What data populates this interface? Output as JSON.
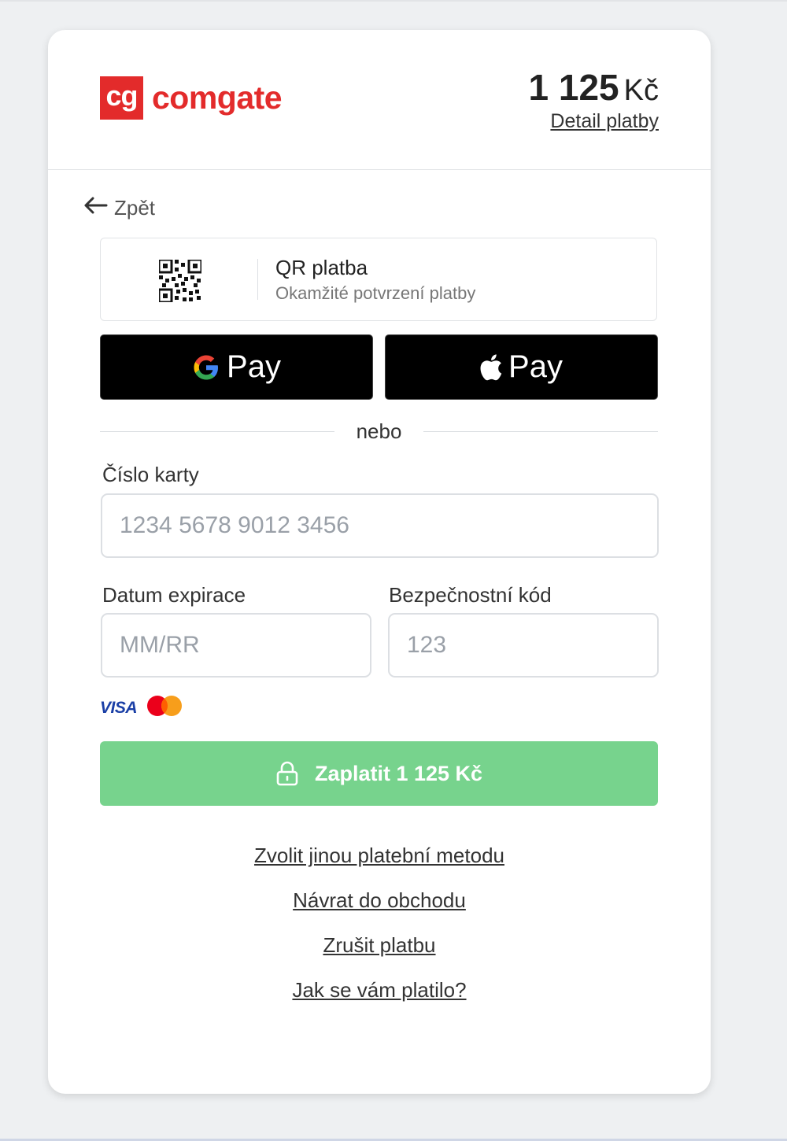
{
  "brand": {
    "logo_mark": "cg",
    "name": "comgate",
    "color": "#e32b2b"
  },
  "payment": {
    "amount": "1 125",
    "currency": "Kč",
    "detail_link": "Detail platby"
  },
  "nav": {
    "back_label": "Zpět"
  },
  "qr_option": {
    "title": "QR platba",
    "subtitle": "Okamžité potvrzení platby"
  },
  "wallets": {
    "google_pay_label": "Pay",
    "apple_pay_label": "Pay"
  },
  "divider_text": "nebo",
  "form": {
    "card_number": {
      "label": "Číslo karty",
      "placeholder": "1234 5678 9012 3456",
      "value": ""
    },
    "expiry": {
      "label": "Datum expirace",
      "placeholder": "MM/RR",
      "value": ""
    },
    "cvc": {
      "label": "Bezpečnostní kód",
      "placeholder": "123",
      "value": ""
    }
  },
  "card_brands": {
    "visa": "VISA",
    "mastercard_icon": "mastercard-icon"
  },
  "submit": {
    "label": "Zaplatit 1 125 Kč",
    "color": "#77d38d"
  },
  "footer_links": [
    "Zvolit jinou platební metodu",
    "Návrat do obchodu",
    "Zrušit platbu",
    "Jak se vám platilo?"
  ]
}
